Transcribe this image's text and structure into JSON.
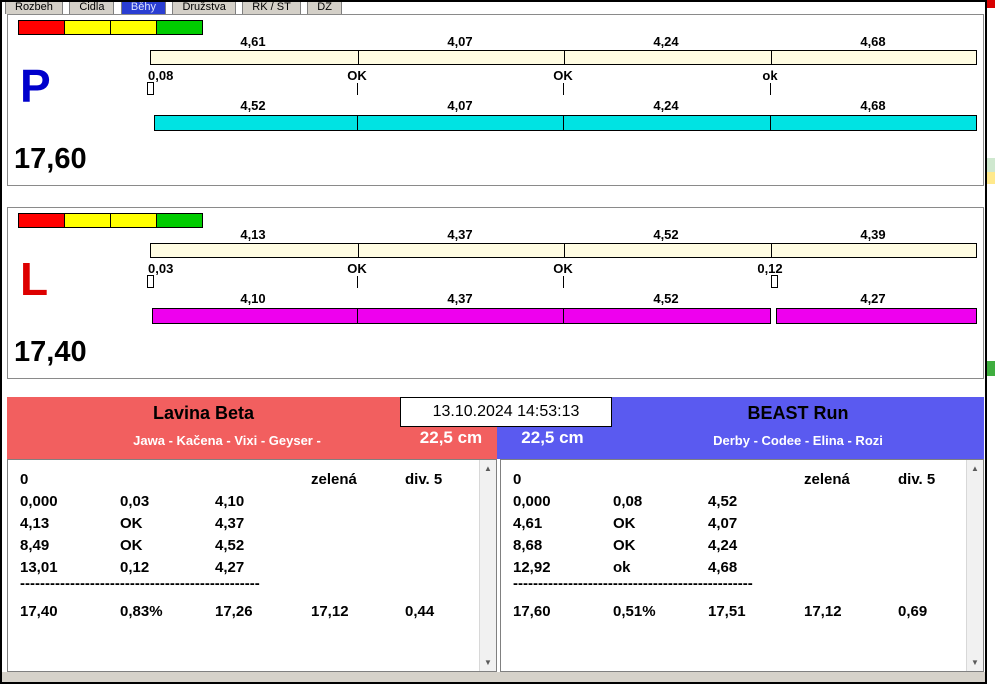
{
  "tabs": {
    "items": [
      {
        "label": "Rozbeh",
        "selected": false
      },
      {
        "label": "Cidla",
        "selected": false
      },
      {
        "label": "Běhy",
        "selected": true
      },
      {
        "label": "Družstva",
        "selected": false
      },
      {
        "label": "RK / ST",
        "selected": false
      },
      {
        "label": "DZ",
        "selected": false
      }
    ]
  },
  "icons": {
    "scroll_up": "▲",
    "scroll_down": "▼"
  },
  "lane_p": {
    "letter": "P",
    "letter_color": "#0000cc",
    "total": "17,60",
    "status_squares": [
      "#ff0000",
      "#ffff00",
      "#ffff00",
      "#00cc00"
    ],
    "upper_segments": [
      "4,61",
      "4,07",
      "4,24",
      "4,68"
    ],
    "crossing_labels": [
      "0,08",
      "OK",
      "OK",
      "ok"
    ],
    "lower_segments": [
      "4,52",
      "4,07",
      "4,24",
      "4,68"
    ],
    "bar_color": "#00e3e3"
  },
  "lane_l": {
    "letter": "L",
    "letter_color": "#dd0000",
    "total": "17,40",
    "status_squares": [
      "#ff0000",
      "#ffff00",
      "#ffff00",
      "#00cc00"
    ],
    "upper_segments": [
      "4,13",
      "4,37",
      "4,52",
      "4,39"
    ],
    "crossing_labels": [
      "0,03",
      "OK",
      "OK",
      "0,12"
    ],
    "lower_segments": [
      "4,10",
      "4,37",
      "4,52",
      "4,27"
    ],
    "bar_color": "#ee00ee"
  },
  "session": {
    "datetime": "13.10.2024 14:53:13"
  },
  "team_left": {
    "name": "Lavina Beta",
    "dogs": "Jawa - Kačena - Vixi - Geyser -",
    "jump_height": "22,5 cm",
    "header_color": "#f25f5f",
    "header_row": {
      "start": "0",
      "light": "zelená",
      "division": "div. 5"
    },
    "rows": [
      [
        "0,000",
        "0,03",
        "4,10"
      ],
      [
        "4,13",
        "OK",
        "4,37"
      ],
      [
        "8,49",
        "OK",
        "4,52"
      ],
      [
        "13,01",
        "0,12",
        "4,27"
      ]
    ],
    "separator": "------------------------------------------------",
    "totals": [
      "17,40",
      "0,83%",
      "17,26",
      "17,12",
      "0,44"
    ]
  },
  "team_right": {
    "name": "BEAST Run",
    "dogs": "Derby - Codee - Elina - Rozi",
    "jump_height": "22,5 cm",
    "header_color": "#5a5af0",
    "header_row": {
      "start": "0",
      "light": "zelená",
      "division": "div. 5"
    },
    "rows": [
      [
        "0,000",
        "0,08",
        "4,52"
      ],
      [
        "4,61",
        "OK",
        "4,07"
      ],
      [
        "8,68",
        "OK",
        "4,24"
      ],
      [
        "12,92",
        "ok",
        "4,68"
      ]
    ],
    "separator": "------------------------------------------------",
    "totals": [
      "17,60",
      "0,51%",
      "17,51",
      "17,12",
      "0,69"
    ]
  }
}
